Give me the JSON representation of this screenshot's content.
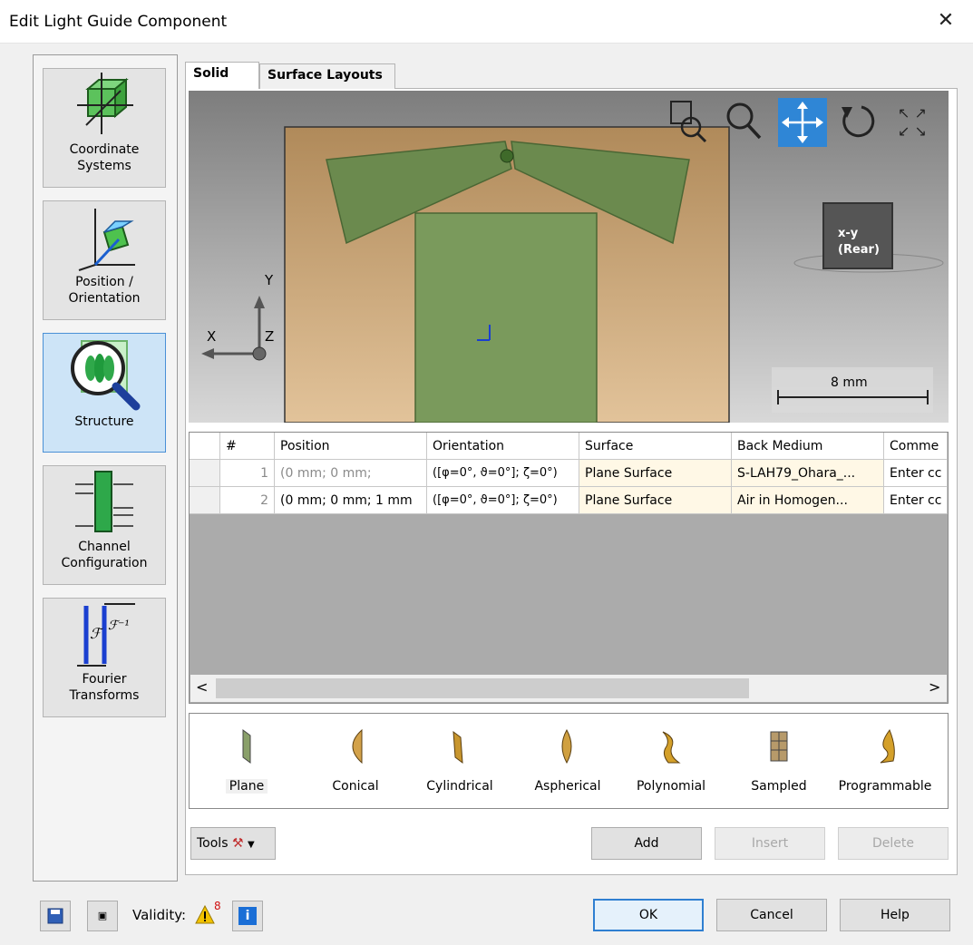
{
  "window": {
    "title": "Edit Light Guide Component",
    "close_glyph": "✕"
  },
  "nav": {
    "items": [
      {
        "label_line1": "Coordinate",
        "label_line2": "Systems",
        "icon": "coordinate-systems-icon"
      },
      {
        "label_line1": "Position /",
        "label_line2": "Orientation",
        "icon": "position-orientation-icon"
      },
      {
        "label_line1": "Structure",
        "label_line2": "",
        "icon": "structure-icon",
        "selected": true
      },
      {
        "label_line1": "Channel",
        "label_line2": "Configuration",
        "icon": "channel-configuration-icon"
      },
      {
        "label_line1": "Fourier",
        "label_line2": "Transforms",
        "icon": "fourier-transforms-icon"
      }
    ]
  },
  "tabs": [
    {
      "label": "Solid",
      "active": true
    },
    {
      "label": "Surface Layouts",
      "active": false
    }
  ],
  "viewport": {
    "axes": {
      "x": "X",
      "y": "Y",
      "z": "Z"
    },
    "view_cube": {
      "line1": "x-y",
      "line2": "(Rear)"
    },
    "scale_label": "8 mm",
    "colors": {
      "plate": "#c8a97a",
      "wing": "#6b8a4e",
      "selected_tool": "#2f86d6"
    }
  },
  "table": {
    "headers": [
      "#",
      "Position",
      "Orientation",
      "Surface",
      "Back Medium",
      "Comme"
    ],
    "rows": [
      {
        "num": "1",
        "position": "(0 mm; 0 mm;",
        "orientation": "([φ=0°, ϑ=0°]; ζ=0°)",
        "surface": "Plane Surface",
        "back_medium": "S-LAH79_Ohara_...",
        "comment": "Enter cc"
      },
      {
        "num": "2",
        "position": "(0 mm; 0 mm; 1 mm",
        "orientation": "([φ=0°, ϑ=0°]; ζ=0°)",
        "surface": "Plane Surface",
        "back_medium": " Air in Homogen...",
        "comment": "Enter cc"
      }
    ],
    "scroll_left": "<",
    "scroll_right": ">"
  },
  "palette": [
    "Plane",
    "Conical",
    "Cylindrical",
    "Aspherical",
    "Polynomial",
    "Sampled",
    "Programmable"
  ],
  "actions": {
    "tools": "Tools",
    "add": "Add",
    "insert": "Insert",
    "delete": "Delete"
  },
  "footer": {
    "validity": "Validity:",
    "warning_count": "8",
    "ok": "OK",
    "cancel": "Cancel",
    "help": "Help"
  }
}
